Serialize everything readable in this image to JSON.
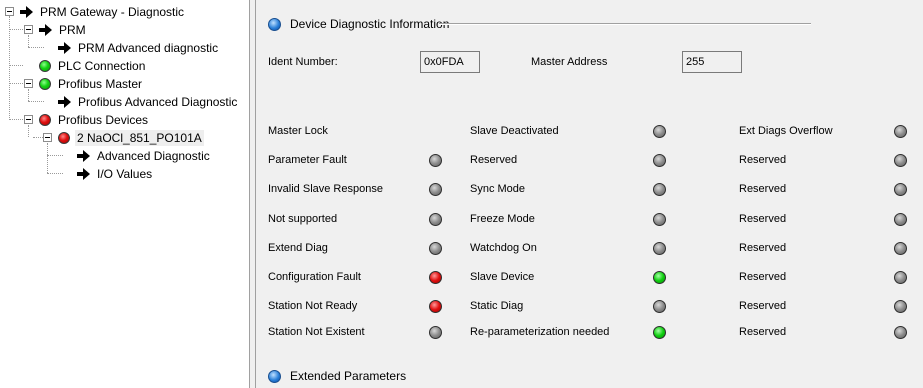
{
  "tree": {
    "root": "PRM Gateway - Diagnostic",
    "items": [
      {
        "label": "PRM",
        "icon": "arrow-icon",
        "status": null
      },
      {
        "label": "PRM Advanced diagnostic",
        "icon": "arrow-icon",
        "status": null
      },
      {
        "label": "PLC Connection",
        "icon": "status-dot-icon",
        "status": "green"
      },
      {
        "label": "Profibus Master",
        "icon": "status-dot-icon",
        "status": "green"
      },
      {
        "label": "Profibus Advanced Diagnostic",
        "icon": "arrow-icon",
        "status": null
      },
      {
        "label": "Profibus Devices",
        "icon": "status-dot-icon",
        "status": "red"
      },
      {
        "label": "2 NaOCl_851_PO101A",
        "icon": "status-dot-icon",
        "status": "red"
      },
      {
        "label": "Advanced Diagnostic",
        "icon": "arrow-icon",
        "status": null
      },
      {
        "label": "I/O Values",
        "icon": "arrow-icon",
        "status": null
      }
    ]
  },
  "device_info": {
    "title": "Device Diagnostic Information",
    "ident_label": "Ident Number:",
    "ident_value": "0x0FDA",
    "master_label": "Master Address",
    "master_value": "255"
  },
  "status_colors": {
    "grey": "#8d8d8d",
    "red": "#e01010",
    "green": "#10cf10"
  },
  "diagnostics": {
    "col1": [
      {
        "label": "Master Lock",
        "state": null
      },
      {
        "label": "Parameter Fault",
        "state": "grey"
      },
      {
        "label": "Invalid Slave Response",
        "state": "grey"
      },
      {
        "label": "Not supported",
        "state": "grey"
      },
      {
        "label": "Extend Diag",
        "state": "grey"
      },
      {
        "label": "Configuration Fault",
        "state": "red"
      },
      {
        "label": "Station Not Ready",
        "state": "red"
      },
      {
        "label": "Station Not Existent",
        "state": "grey"
      }
    ],
    "col2": [
      {
        "label": "Slave Deactivated",
        "state": "grey"
      },
      {
        "label": "Reserved",
        "state": "grey"
      },
      {
        "label": "Sync Mode",
        "state": "grey"
      },
      {
        "label": "Freeze Mode",
        "state": "grey"
      },
      {
        "label": "Watchdog On",
        "state": "grey"
      },
      {
        "label": "Slave Device",
        "state": "green"
      },
      {
        "label": "Static Diag",
        "state": "grey"
      },
      {
        "label": "Re-parameterization needed",
        "state": "green"
      }
    ],
    "col3": [
      {
        "label": "Ext Diags Overflow",
        "state": "grey"
      },
      {
        "label": "Reserved",
        "state": "grey"
      },
      {
        "label": "Reserved",
        "state": "grey"
      },
      {
        "label": "Reserved",
        "state": "grey"
      },
      {
        "label": "Reserved",
        "state": "grey"
      },
      {
        "label": "Reserved",
        "state": "grey"
      },
      {
        "label": "Reserved",
        "state": "grey"
      },
      {
        "label": "Reserved",
        "state": "grey"
      }
    ]
  },
  "extended": {
    "title": "Extended Parameters"
  }
}
